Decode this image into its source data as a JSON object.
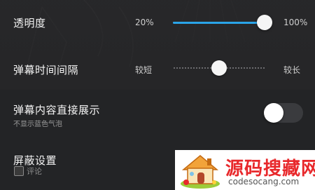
{
  "settings": {
    "opacity": {
      "label": "透明度",
      "min_label": "20%",
      "max_label": "100%",
      "value_percent": 100
    },
    "duration": {
      "label": "弹幕时间间隔",
      "min_label": "较短",
      "max_label": "较长",
      "position_fraction": 0.5
    },
    "direct_show": {
      "label": "弹幕内容直接展示",
      "sublabel": "不显示蓝色气泡",
      "enabled": false
    },
    "block": {
      "label": "屏蔽设置",
      "checkbox_label": "评论"
    }
  },
  "watermark": {
    "title": "源码搜藏网",
    "url": "codesocang.com"
  },
  "colors": {
    "accent": "#2aa4e8",
    "background": "#232426",
    "watermark_red": "#e8282b"
  }
}
